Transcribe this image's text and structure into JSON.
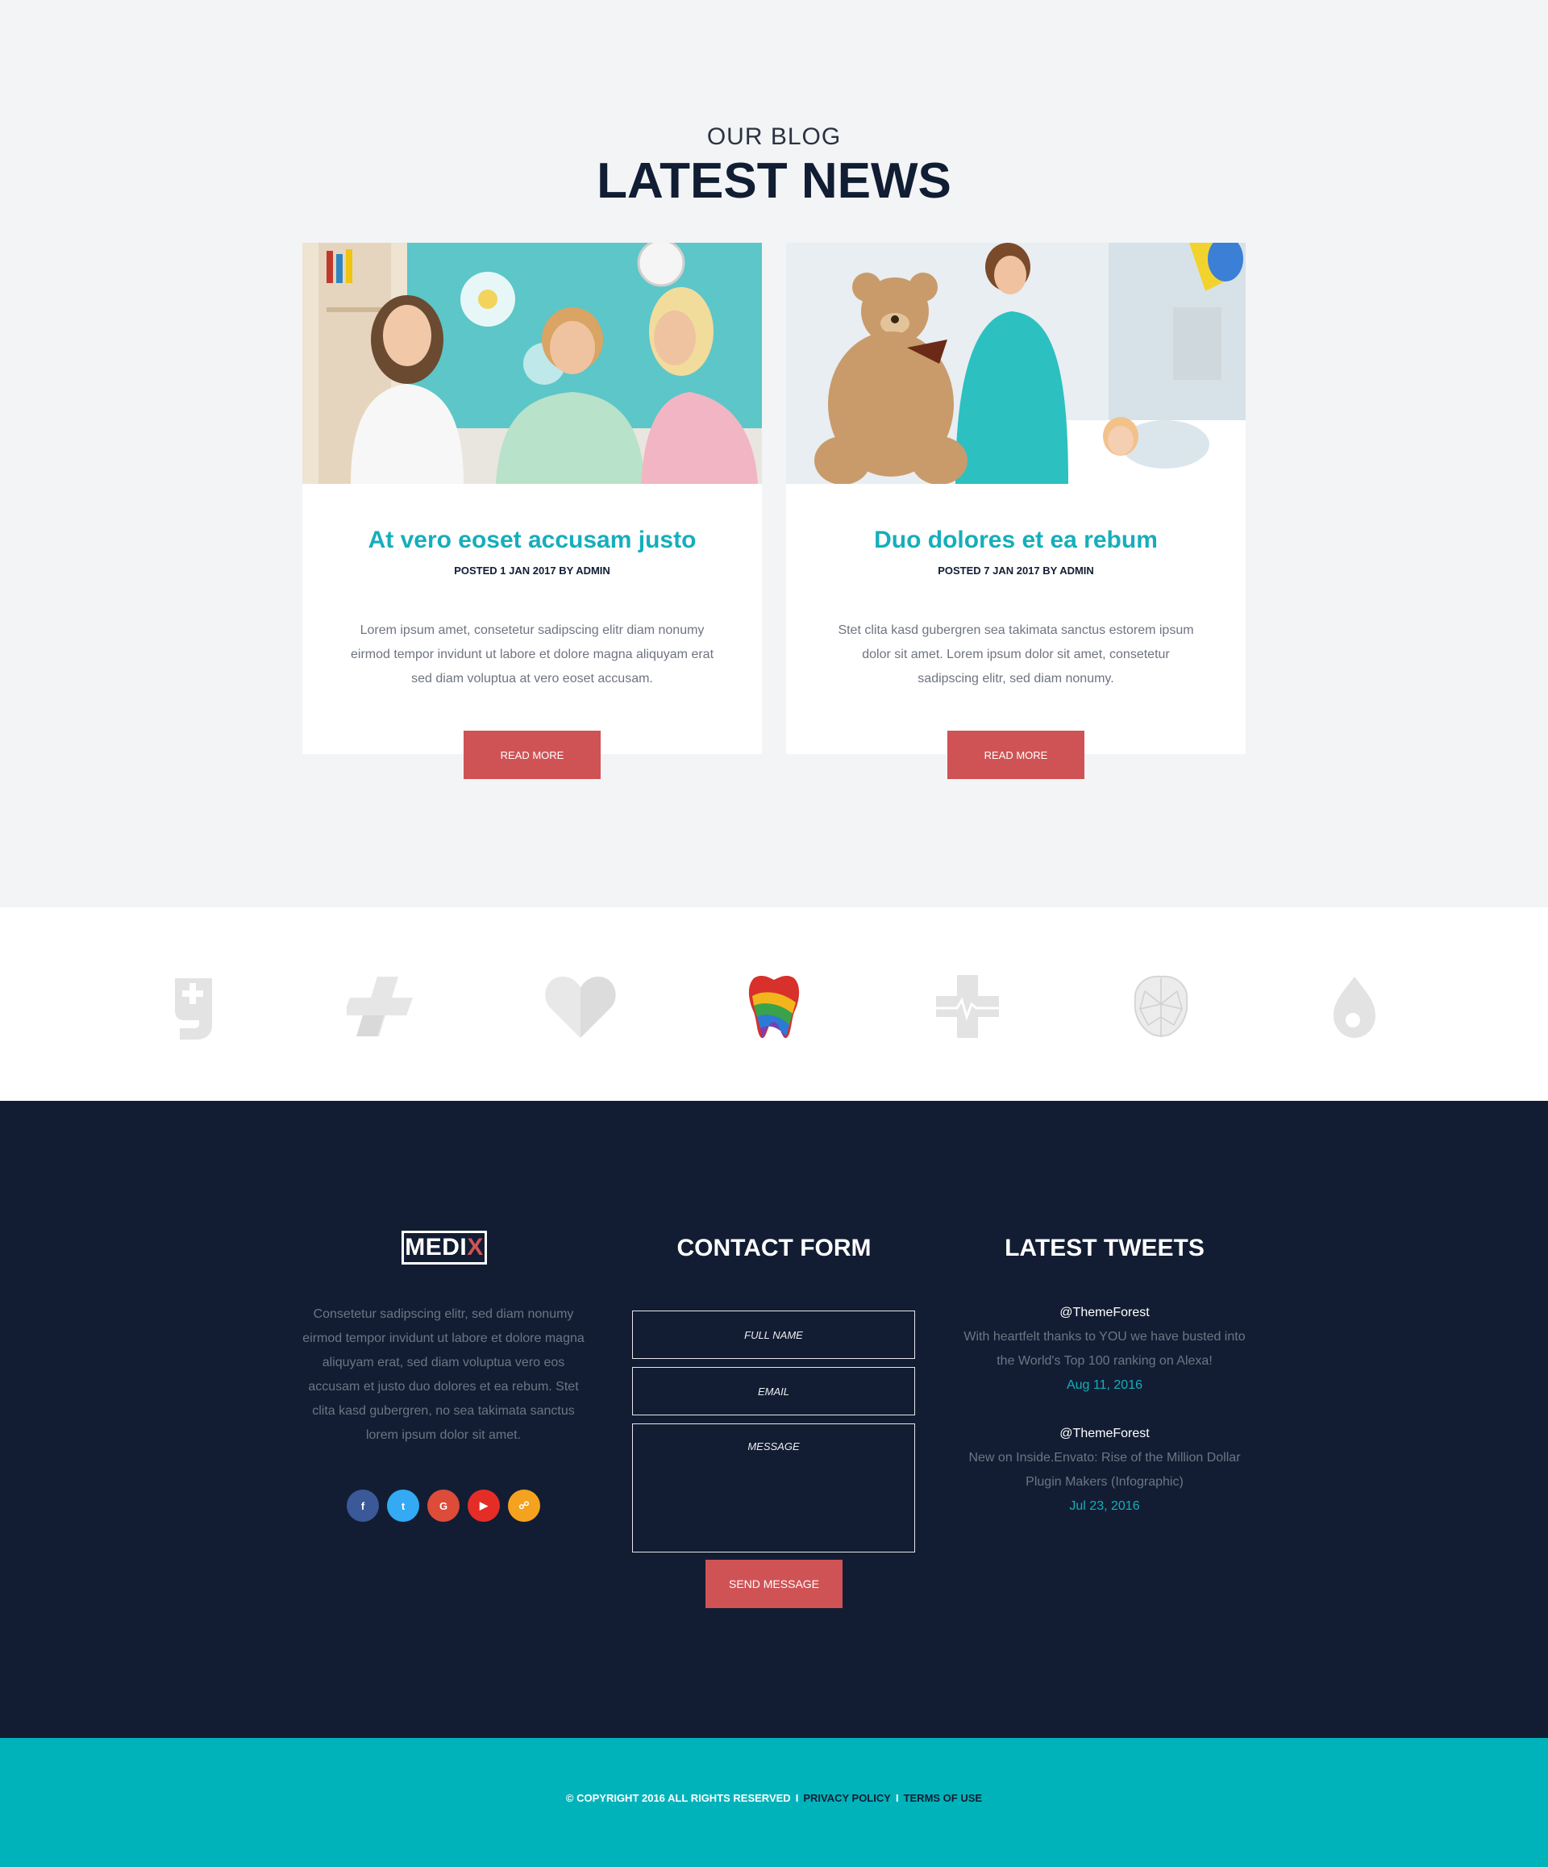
{
  "blog": {
    "subtitle": "OUR BLOG",
    "title": "LATEST NEWS",
    "posts": [
      {
        "title": "At vero eoset accusam justo",
        "meta": "POSTED 1 JAN 2017 BY ADMIN",
        "excerpt": "Lorem ipsum amet, consetetur sadipscing elitr diam nonumy eirmod tempor invidunt ut labore et dolore magna aliquyam erat sed diam voluptua at vero eoset accusam.",
        "button": "READ MORE"
      },
      {
        "title": "Duo dolores et ea rebum",
        "meta": "POSTED 7 JAN 2017  BY ADMIN",
        "excerpt": "Stet clita kasd gubergren sea takimata sanctus estorem ipsum dolor sit amet. Lorem ipsum dolor sit amet, consetetur sadipscing elitr, sed diam nonumy.",
        "button": "READ MORE"
      }
    ]
  },
  "partners": {
    "icons": [
      "g-plus-logo-icon",
      "cross-logo-icon",
      "heart-logo-icon",
      "tooth-logo-icon",
      "medical-cross-pulse-icon",
      "brain-logo-icon",
      "drop-logo-icon"
    ]
  },
  "footer": {
    "brand": {
      "main": "MEDI",
      "accent": "X"
    },
    "about": "Consetetur sadipscing elitr, sed diam nonumy eirmod tempor invidunt ut labore et dolore magna aliquyam erat, sed diam voluptua vero eos accusam et justo duo dolores et ea rebum. Stet clita kasd gubergren, no sea takimata sanctus lorem ipsum dolor sit amet.",
    "socials": [
      {
        "name": "facebook-icon",
        "glyph": "f",
        "color": "#3b5998"
      },
      {
        "name": "twitter-icon",
        "glyph": "t",
        "color": "#33aaf3"
      },
      {
        "name": "google-plus-icon",
        "glyph": "G",
        "color": "#dd4b39"
      },
      {
        "name": "youtube-icon",
        "glyph": "▶",
        "color": "#e52d27"
      },
      {
        "name": "rss-icon",
        "glyph": "☍",
        "color": "#f5a21e"
      }
    ],
    "contact": {
      "title": "CONTACT FORM",
      "name_placeholder": "FULL NAME",
      "email_placeholder": "EMAIL",
      "message_placeholder": "MESSAGE",
      "send_label": "SEND MESSAGE"
    },
    "tweets": {
      "title": "LATEST TWEETS",
      "items": [
        {
          "handle": "@ThemeForest",
          "text": "With heartfelt thanks to YOU we have busted into the World's Top 100 ranking on Alexa!",
          "date": "Aug 11, 2016"
        },
        {
          "handle": "@ThemeForest",
          "text": "New on Inside.Envato: Rise of the Million Dollar Plugin Makers (Infographic)",
          "date": "Jul 23, 2016"
        }
      ]
    }
  },
  "bottom": {
    "copyright": "© COPYRIGHT 2016 ALL RIGHTS RESERVED",
    "separator": "I",
    "privacy": "PRIVACY POLICY",
    "terms": "TERMS OF USE"
  },
  "colors": {
    "accent_teal": "#16aebb",
    "button_red": "#cf5355",
    "navy": "#121d33",
    "bottom_bar": "#00b3ba"
  }
}
